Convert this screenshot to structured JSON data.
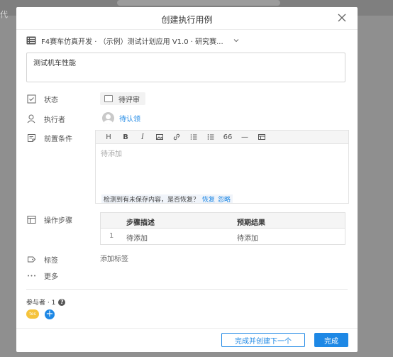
{
  "background": {
    "left_text": "代"
  },
  "modal": {
    "title": "创建执行用例",
    "plan_selector": "F4赛车仿真开发 · （示例）测试计划应用 V1.0 · 研究赛...",
    "title_value": "测试机车性能",
    "fields": {
      "status_label": "状态",
      "status_value": "待评审",
      "assignee_label": "执行者",
      "assignee_value": "待认领",
      "precondition_label": "前置条件",
      "steps_label": "操作步骤",
      "tags_label": "标签",
      "more_label": "更多"
    },
    "editor": {
      "toolbar": [
        "H",
        "B",
        "I",
        "image-icon",
        "link-icon",
        "ordered-list-icon",
        "bullet-list-icon",
        "66",
        "—",
        "table-icon"
      ],
      "placeholder": "待添加",
      "restore_prompt": "检测到有未保存内容，是否恢复？",
      "restore_link": "恢复",
      "ignore_link": "忽略"
    },
    "steps_table": {
      "headers": [
        "步骤描述",
        "预期结果"
      ],
      "rows": [
        {
          "num": "1",
          "desc": "待添加",
          "expected": "待添加"
        }
      ]
    },
    "tags_add": "添加标签",
    "participants_label": "参与者 · 1",
    "participant_avatar_text": "tes",
    "footer": {
      "secondary_button": "完成并创建下一个",
      "primary_button": "完成"
    }
  },
  "colors": {
    "accent": "#1e88e5",
    "avatar_yellow": "#f5c33b"
  }
}
